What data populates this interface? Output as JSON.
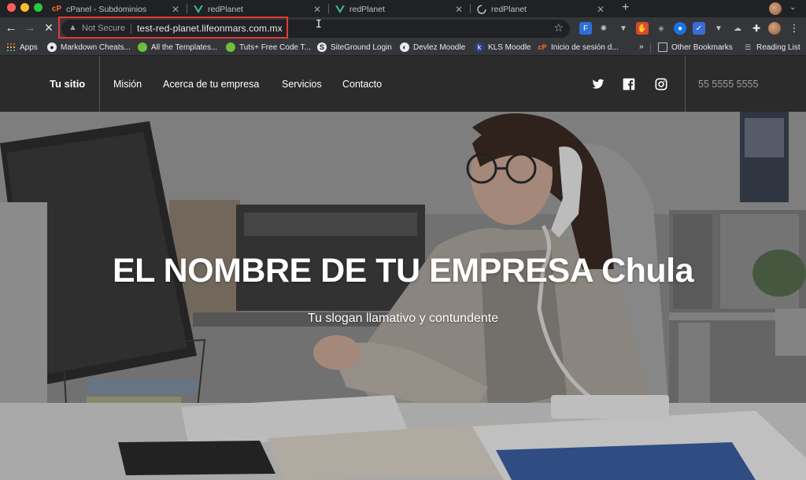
{
  "browser": {
    "tabs": [
      {
        "title": "cPanel - Subdominios",
        "active": true
      },
      {
        "title": "redPlanet",
        "active": false
      },
      {
        "title": "redPlanet",
        "active": false
      },
      {
        "title": "redPlanet",
        "active": false
      }
    ],
    "omnibox": {
      "security_label": "Not Secure",
      "url": "test-red-planet.lifeonmars.com.mx"
    },
    "bookmarks": [
      {
        "label": "Apps",
        "icon": "apps-grid-icon"
      },
      {
        "label": "Markdown Cheats...",
        "icon": "github-icon"
      },
      {
        "label": "All the Templates...",
        "icon": "leaf-icon"
      },
      {
        "label": "Tuts+ Free Code T...",
        "icon": "leaf-icon"
      },
      {
        "label": "SiteGround Login",
        "icon": "siteground-icon"
      },
      {
        "label": "Devlez Moodle",
        "icon": "globe-icon"
      },
      {
        "label": "KLS Moodle",
        "icon": "kls-icon"
      },
      {
        "label": "Inicio de sesión d...",
        "icon": "cpanel-icon"
      }
    ],
    "overflow_label": "»",
    "other_bookmarks": "Other Bookmarks",
    "reading_list": "Reading List"
  },
  "site": {
    "brand": "Tu sitio",
    "menu": [
      "Misión",
      "Acerca de tu empresa",
      "Servicios",
      "Contacto"
    ],
    "social": [
      "twitter-icon",
      "facebook-icon",
      "instagram-icon"
    ],
    "phone": "55 5555 5555",
    "hero": {
      "title": "EL NOMBRE DE TU EMPRESA Chula",
      "subtitle": "Tu slogan llamativo y contundente"
    }
  },
  "colors": {
    "nav_bg": "#2b2b2b",
    "highlight": "#e53935",
    "browser_chrome": "#35363a"
  }
}
